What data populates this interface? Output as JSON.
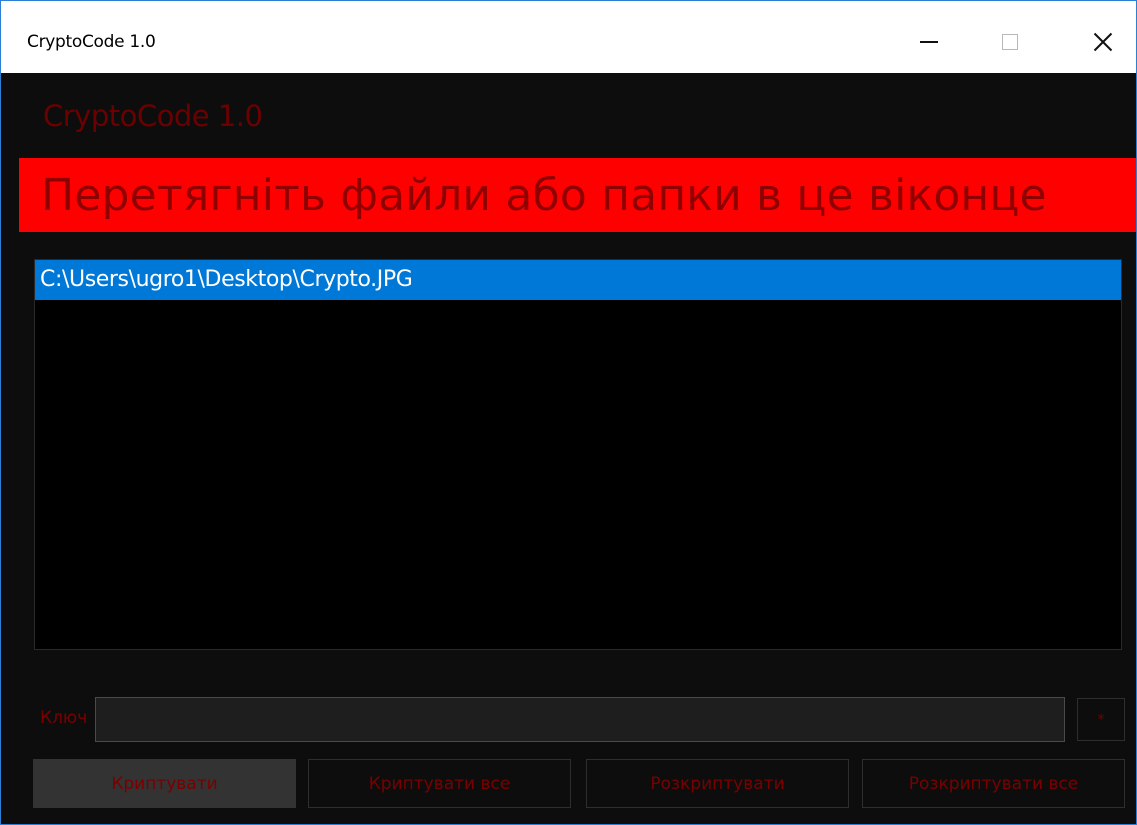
{
  "window": {
    "title": "CryptoCode 1.0"
  },
  "app": {
    "heading": "CryptoCode 1.0"
  },
  "drop_zone": {
    "text": "Перетягніть файли або папки в це віконце"
  },
  "file_list": {
    "items": [
      "C:\\Users\\ugro1\\Desktop\\Crypto.JPG"
    ],
    "selected_index": 0
  },
  "key": {
    "label": "Ключ",
    "value": "",
    "toggle_label": "*"
  },
  "actions": {
    "encrypt": "Криптувати",
    "encrypt_all": "Криптувати все",
    "decrypt": "Розкриптувати",
    "decrypt_all": "Розкриптувати все"
  },
  "colors": {
    "banner_bg": "#ff0000",
    "banner_text": "#8f0000",
    "heading_text": "#6b0000",
    "selection": "#0078d7",
    "window_bg": "#0d0d0d"
  }
}
